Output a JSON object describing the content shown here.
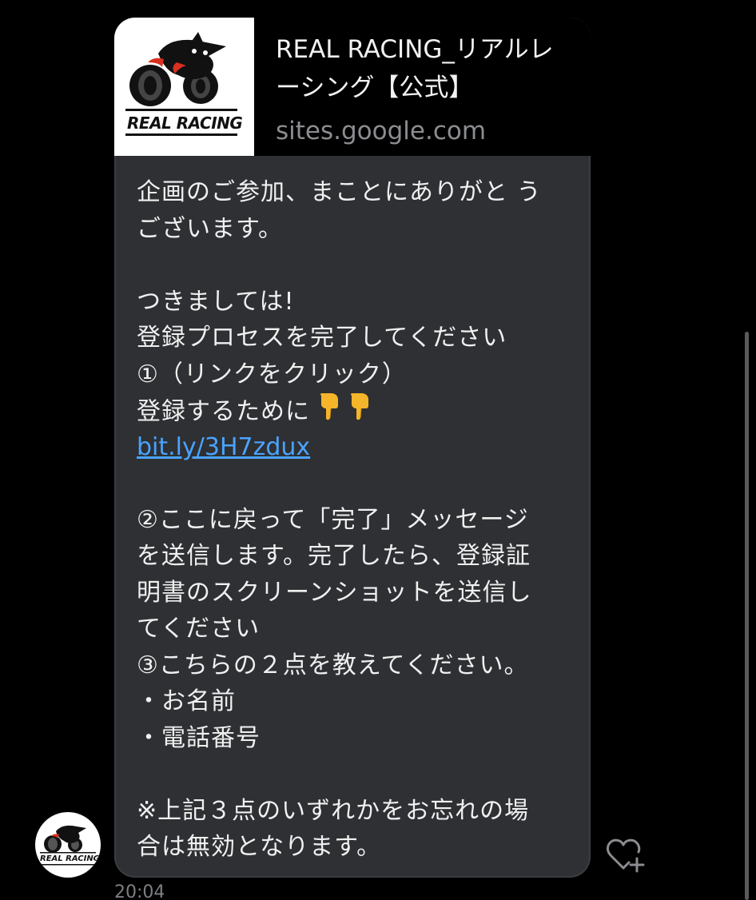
{
  "link_card": {
    "logo_text": "REAL RACING",
    "title": "REAL RACING_リアルレーシング【公式】",
    "domain": "sites.google.com"
  },
  "message": {
    "lines": [
      "企画のご参加、まことにありがと う",
      "ございます。",
      "",
      "つきましては!",
      "登録プロセスを完了してください",
      "①（リンクをクリック）",
      "登録するために",
      "",
      "",
      "②ここに戻って「完了」メッセージ",
      "を送信します。完了したら、登録証",
      "明書のスクリーンショットを送信し",
      "てください",
      "③こちらの２点を教えてください。",
      "・お名前",
      "・電話番号",
      "",
      "※上記３点のいずれかをお忘れの場",
      "合は無効となります。"
    ],
    "link": "bit.ly/3H7zdux",
    "pointing_emoji": "pointing-down-hand-emoji"
  },
  "avatar": {
    "logo_text": "REAL RACING"
  },
  "timestamp": "20:04",
  "colors": {
    "background": "#000000",
    "bubble": "#2e3033",
    "link": "#4aa3ff",
    "emoji": "#f5b52a"
  }
}
